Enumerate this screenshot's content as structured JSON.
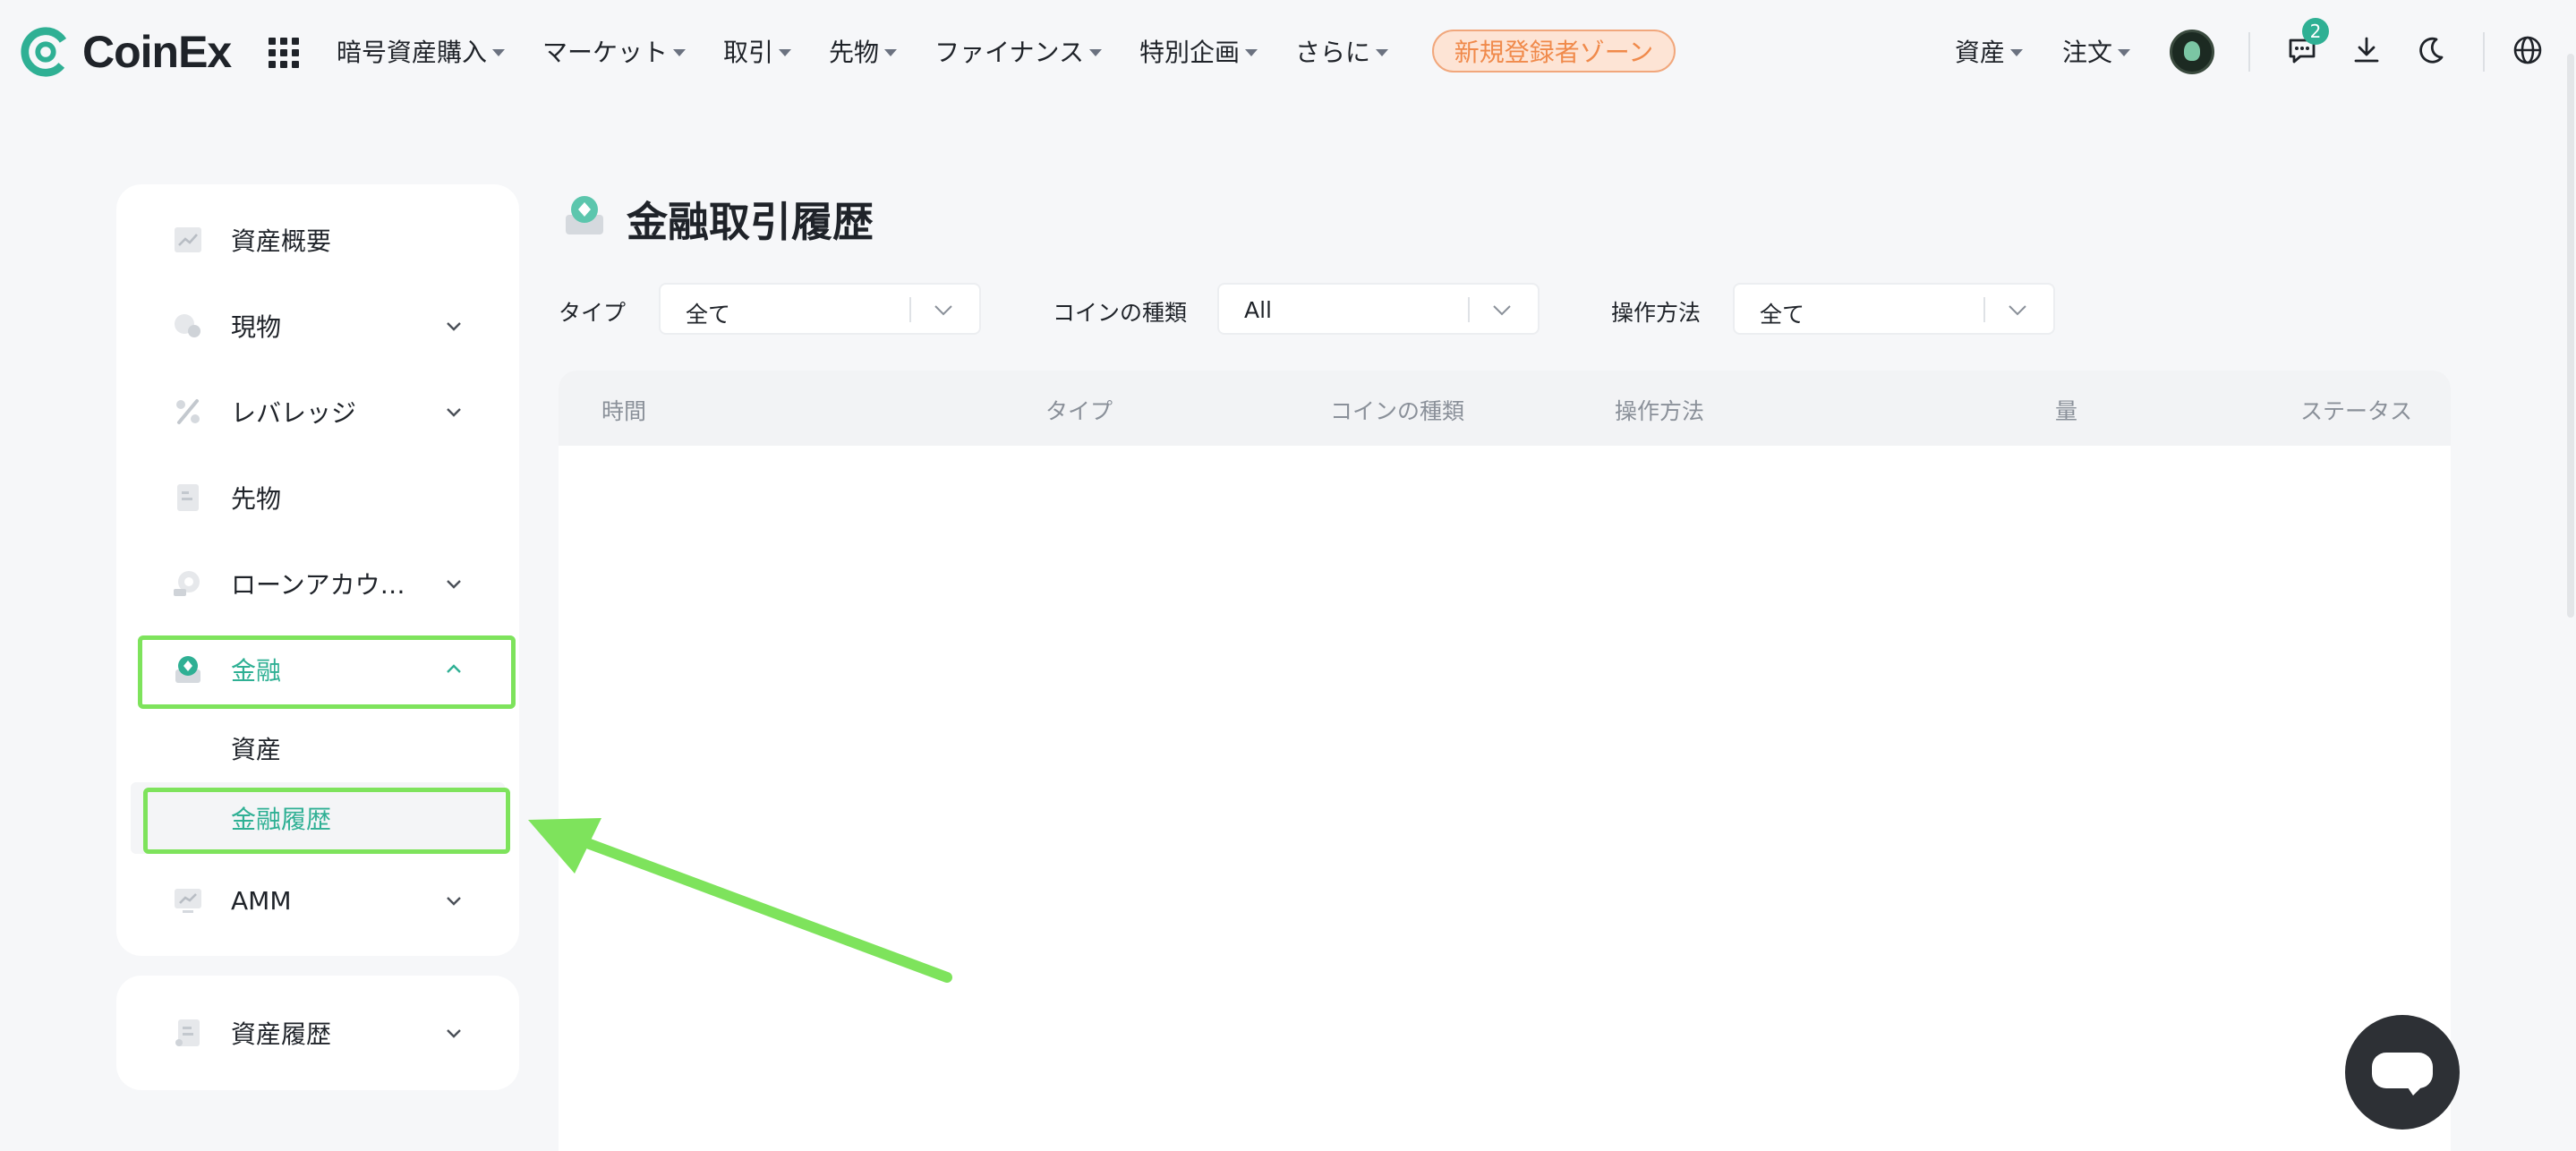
{
  "brand": {
    "name": "CoinEx",
    "accent": "#2fb094"
  },
  "nav": {
    "items": [
      {
        "label": "暗号資産購入"
      },
      {
        "label": "マーケット"
      },
      {
        "label": "取引"
      },
      {
        "label": "先物"
      },
      {
        "label": "ファイナンス"
      },
      {
        "label": "特別企画"
      },
      {
        "label": "さらに"
      }
    ],
    "promo": "新規登録者ゾーン",
    "assets": "資産",
    "orders": "注文",
    "message_count": "2"
  },
  "sidebar": {
    "items": [
      {
        "label": "資産概要",
        "icon": "chart-card-icon"
      },
      {
        "label": "現物",
        "icon": "coins-icon"
      },
      {
        "label": "レバレッジ",
        "icon": "percent-icon"
      },
      {
        "label": "先物",
        "icon": "document-icon"
      },
      {
        "label": "ローンアカウ…",
        "icon": "loan-icon"
      },
      {
        "label": "金融",
        "icon": "finance-icon"
      },
      {
        "label": "AMM",
        "icon": "amm-icon"
      }
    ],
    "finance_sub": [
      {
        "label": "資産"
      },
      {
        "label": "金融履歴"
      }
    ],
    "history": {
      "label": "資産履歴",
      "icon": "history-doc-icon"
    }
  },
  "main": {
    "title": "金融取引履歴",
    "filters": [
      {
        "label": "タイプ",
        "value": "全て"
      },
      {
        "label": "コインの種類",
        "value": "All"
      },
      {
        "label": "操作方法",
        "value": "全て"
      }
    ],
    "table": {
      "columns": [
        "時間",
        "タイプ",
        "コインの種類",
        "操作方法",
        "量",
        "ステータス"
      ]
    }
  },
  "colors": {
    "highlight": "#7ee35c",
    "active_text": "#2fb094",
    "promo_text": "#f08a4b",
    "promo_bg": "#fde4d5"
  }
}
